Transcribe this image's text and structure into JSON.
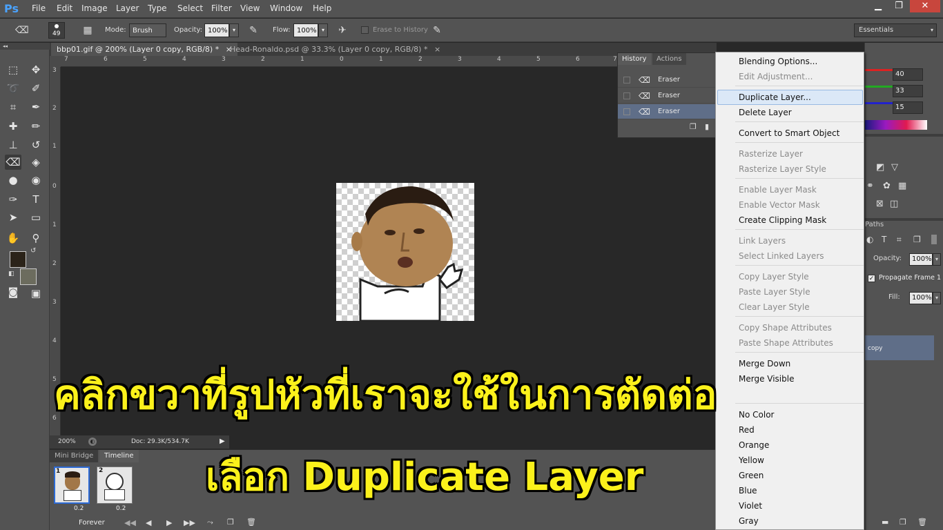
{
  "menubar": {
    "logo": "Ps",
    "items": [
      "File",
      "Edit",
      "Image",
      "Layer",
      "Type",
      "Select",
      "Filter",
      "View",
      "Window",
      "Help"
    ],
    "win_min": "▁",
    "win_max": "❐",
    "win_close": "✕"
  },
  "options": {
    "brush_size": "49",
    "mode_label": "Mode:",
    "mode_value": "Brush",
    "opacity_label": "Opacity:",
    "opacity_value": "100%",
    "flow_label": "Flow:",
    "flow_value": "100%",
    "erase_history": "Erase to History",
    "workspace": "Essentials"
  },
  "tabs": [
    {
      "label": "bbp01.gif @ 200% (Layer 0 copy, RGB/8) *",
      "close": "×"
    },
    {
      "label": "Head-Ronaldo.psd @ 33.3% (Layer 0 copy, RGB/8) *",
      "close": "×"
    }
  ],
  "ruler_top": [
    "7",
    "6",
    "5",
    "4",
    "3",
    "2",
    "1",
    "0",
    "1",
    "2",
    "3",
    "4",
    "5",
    "6",
    "7"
  ],
  "ruler_left": [
    "3",
    "2",
    "1",
    "0",
    "1",
    "2",
    "3",
    "4",
    "5",
    "6"
  ],
  "status": {
    "zoom": "200%",
    "doc": "Doc: 29.3K/534.7K"
  },
  "bottom": {
    "tab_bridge": "Mini Bridge",
    "tab_timeline": "Timeline",
    "frame1_num": "1",
    "frame2_num": "2",
    "frame1_delay": "0.2",
    "frame2_delay": "0.2",
    "loop": "Forever"
  },
  "history": {
    "tab_history": "History",
    "tab_actions": "Actions",
    "rows": [
      "Eraser",
      "Eraser",
      "Eraser"
    ]
  },
  "right": {
    "r_value": "40",
    "g_value": "33",
    "b_value": "15",
    "paths_tab": "Paths",
    "opacity_label": "Opacity:",
    "opacity_value": "100%",
    "propagate": "Propagate Frame 1",
    "fill_label": "Fill:",
    "fill_value": "100%",
    "layer_copy": "copy"
  },
  "context_menu": {
    "blending_options": "Blending Options...",
    "edit_adjustment": "Edit Adjustment...",
    "duplicate_layer": "Duplicate Layer...",
    "delete_layer": "Delete Layer",
    "convert_smart": "Convert to Smart Object",
    "rasterize_layer": "Rasterize Layer",
    "rasterize_style": "Rasterize Layer Style",
    "enable_layer_mask": "Enable Layer Mask",
    "enable_vector_mask": "Enable Vector Mask",
    "create_clipping": "Create Clipping Mask",
    "link_layers": "Link Layers",
    "select_linked": "Select Linked Layers",
    "copy_style": "Copy Layer Style",
    "paste_style": "Paste Layer Style",
    "clear_style": "Clear Layer Style",
    "copy_shape": "Copy Shape Attributes",
    "paste_shape": "Paste Shape Attributes",
    "merge_down": "Merge Down",
    "merge_visible": "Merge Visible",
    "no_color": "No Color",
    "red": "Red",
    "orange": "Orange",
    "yellow": "Yellow",
    "green": "Green",
    "blue": "Blue",
    "violet": "Violet",
    "gray": "Gray"
  },
  "overlay": {
    "line1": "คลิกขวาที่รูปหัวที่เราจะใช้ในการตัดต่อ",
    "line2": "เลือก Duplicate Layer"
  },
  "colors": {
    "overlay_text": "#fbf11b",
    "highlight": "#dbe8f7",
    "ps_blue": "#4aa3ff",
    "foreground": "#2b2319"
  }
}
